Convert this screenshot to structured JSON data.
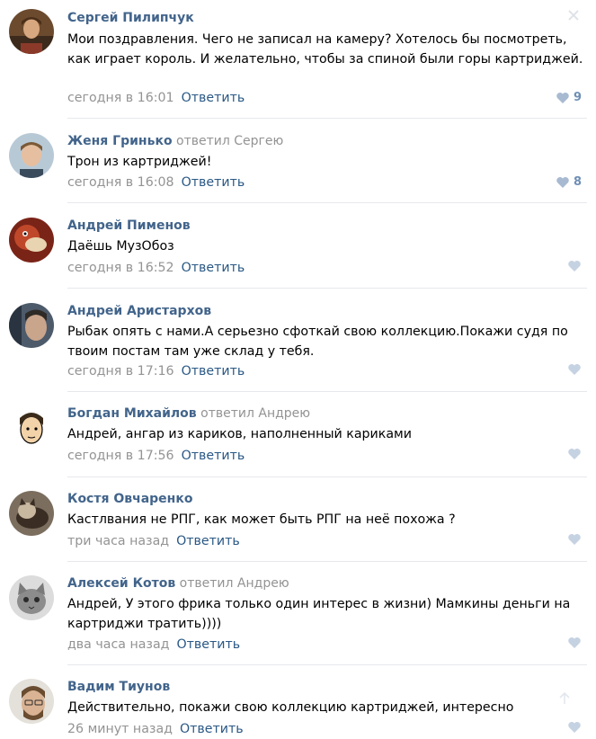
{
  "reply_label": "Ответить",
  "comments": [
    {
      "author": "Сергей Пилипчук",
      "replied": "",
      "text": "Мои поздравления. Чего не записал на камеру? Хотелось бы посмотреть, как играет король. И желательно, чтобы за спиной были горы картриджей.",
      "time": "сегодня в 16:01",
      "likes": "9"
    },
    {
      "author": "Женя Гринько",
      "replied": "ответил Сергею",
      "text": "Трон из картриджей!",
      "time": "сегодня в 16:08",
      "likes": "8"
    },
    {
      "author": "Андрей Пименов",
      "replied": "",
      "text": "Даёшь МузОбоз",
      "time": "сегодня в 16:52",
      "likes": ""
    },
    {
      "author": "Андрей Аристархов",
      "replied": "",
      "text": "Рыбак опять с нами.А серьезно сфоткай свою коллекцию.Покажи судя по твоим постам там уже склад у тебя.",
      "time": "сегодня в 17:16",
      "likes": ""
    },
    {
      "author": "Богдан Михайлов",
      "replied": "ответил Андрею",
      "text": "Андрей, ангар из кариков, наполненный кариками",
      "time": "сегодня в 17:56",
      "likes": ""
    },
    {
      "author": "Костя Овчаренко",
      "replied": "",
      "text": "Кастлвания не РПГ, как может быть РПГ на неё похожа ?",
      "time": "три часа назад",
      "likes": ""
    },
    {
      "author": "Алексей Котов",
      "replied": "ответил Андрею",
      "text": "Андрей, У этого фрика только один интерес в жизни) Мамкины деньги на картриджи тратить))))",
      "time": "два часа назад",
      "likes": ""
    },
    {
      "author": "Вадим Тиунов",
      "replied": "",
      "text": "Действительно, покажи свою коллекцию картриджей, интересно",
      "time": "26 минут назад",
      "likes": ""
    }
  ]
}
